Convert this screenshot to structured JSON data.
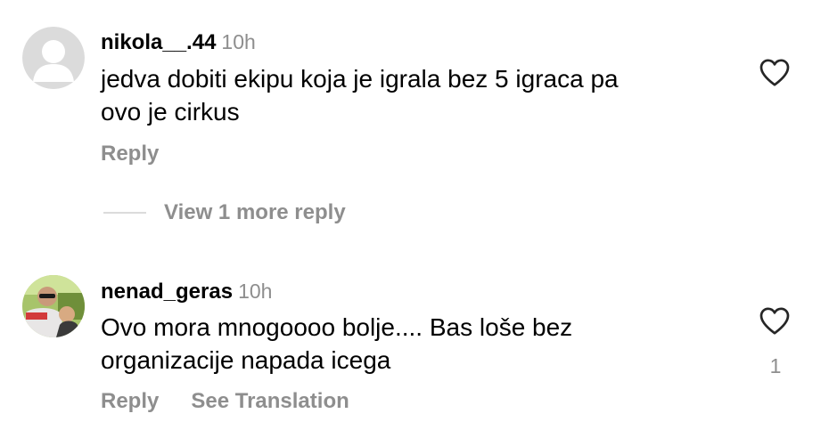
{
  "comments": [
    {
      "username": "nikola__.44",
      "time": "10h",
      "text_lines": [
        "jedva dobiti ekipu koja je igrala bez 5 igraca pa",
        "ovo je cirkus"
      ],
      "reply_label": "Reply",
      "avatar_icon": "default-user-icon",
      "like_icon": "heart-outline-icon",
      "like_count": ""
    },
    {
      "username": "nenad_geras",
      "time": "10h",
      "text_lines": [
        "Ovo mora mnogoooo bolje.... Bas loše bez",
        "organizacije napada icega"
      ],
      "reply_label": "Reply",
      "translation_label": "See Translation",
      "avatar_icon": "profile-photo",
      "like_icon": "heart-outline-icon",
      "like_count": "1"
    }
  ],
  "view_replies_label": "View 1 more reply",
  "colors": {
    "secondary_text": "#8e8e8e",
    "divider": "#dbdbdb",
    "avatar_bg": "#dbdbdb",
    "avatar_fg": "#ffffff"
  }
}
